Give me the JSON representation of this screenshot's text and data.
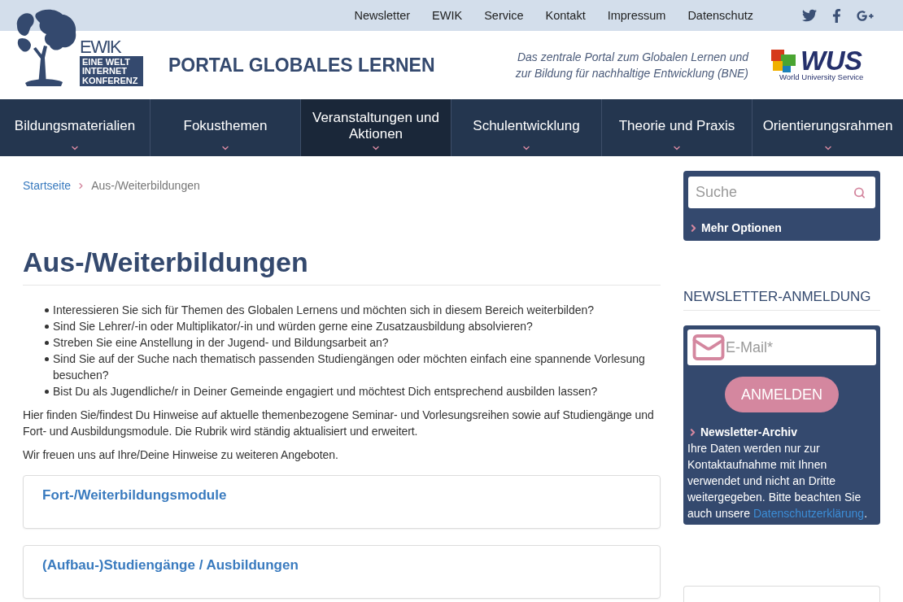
{
  "top_links": [
    "Newsletter",
    "EWIK",
    "Service",
    "Kontakt",
    "Impressum",
    "Datenschutz"
  ],
  "header": {
    "logo": {
      "name": "EWIK",
      "subtitle_lines": [
        "EINE WELT",
        "INTERNET",
        "KONFERENZ"
      ]
    },
    "site_title": "PORTAL GLOBALES LERNEN",
    "tagline_lines": [
      "Das zentrale Portal zum Globalen Lernen und",
      "zur Bildung für nachhaltige Entwicklung (BNE)"
    ],
    "partner_logo": {
      "name": "WUS",
      "full_name": "World University Service"
    }
  },
  "main_nav": [
    {
      "label": "Bildungsmaterialien",
      "selected": false
    },
    {
      "label": "Fokusthemen",
      "selected": false
    },
    {
      "label": "Veranstaltungen und Aktionen",
      "selected": true
    },
    {
      "label": "Schulentwicklung",
      "selected": false
    },
    {
      "label": "Theorie und Praxis",
      "selected": false
    },
    {
      "label": "Orientierungsrahmen",
      "selected": false
    }
  ],
  "breadcrumb": [
    {
      "label": "Startseite",
      "kind": "link"
    },
    {
      "label": "Aus-/Weiterbildungen",
      "kind": "current"
    }
  ],
  "content": {
    "title": "Aus-/Weiterbildungen",
    "bullets": [
      "Interessieren Sie sich für Themen des Globalen Lernens und möchten sich in diesem Bereich weiterbilden?",
      "Sind Sie Lehrer/-in oder Multiplikator/-in und würden gerne eine Zusatzausbildung absolvieren?",
      "Streben Sie eine Anstellung in der Jugend- und Bildungsarbeit an?",
      "Sind Sie auf der Suche nach thematisch passenden Studiengängen oder möchten einfach eine spannende Vorlesung besuchen?",
      "Bist Du als Jugendliche/r in Deiner Gemeinde engagiert und möchtest Dich entsprechend ausbilden lassen?"
    ],
    "paragraphs": [
      "Hier finden Sie/findest Du Hinweise auf aktuelle themenbezogene Seminar- und Vorlesungsreihen sowie auf Studiengänge und Fort- und Ausbildungsmodule. Die Rubrik wird ständig aktualisiert und erweitert.",
      "Wir freuen uns auf Ihre/Deine Hinweise zu weiteren Angeboten."
    ],
    "sections": [
      {
        "title": "Fort-/Weiterbildungsmodule"
      },
      {
        "title": "(Aufbau-)Studiengänge / Ausbildungen"
      }
    ]
  },
  "sidebar": {
    "search": {
      "placeholder": "Suche",
      "more_options": "Mehr Optionen"
    },
    "newsletter": {
      "heading": "NEWSLETTER-ANMELDUNG",
      "email": {
        "placeholder": "E-Mail*"
      },
      "button": "ANMELDEN",
      "archive_link": "Newsletter-Archiv",
      "privacy_note": {
        "text": "Ihre Daten werden nur zur Kontaktaufnahme mit Ihnen verwendet und nicht an Dritte weitergegeben. Bitte beachten Sie auch unsere",
        "link": "Datenschutzerklärung",
        "end": "."
      }
    }
  }
}
